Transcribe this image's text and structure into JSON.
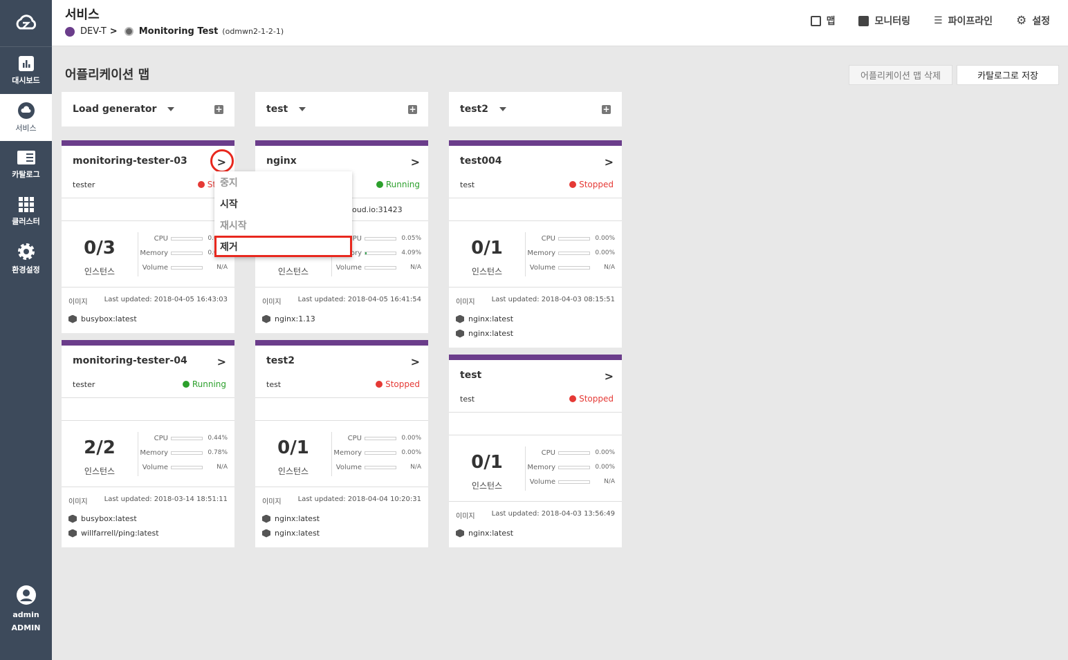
{
  "sidebar": {
    "items": [
      {
        "label": "대시보드",
        "icon": "bar-chart-icon"
      },
      {
        "label": "서비스",
        "icon": "cloud-icon"
      },
      {
        "label": "카탈로그",
        "icon": "book-icon"
      },
      {
        "label": "클러스터",
        "icon": "grid-icon"
      },
      {
        "label": "환경설정",
        "icon": "gear-icon"
      }
    ],
    "user": {
      "name": "admin",
      "role": "ADMIN"
    }
  },
  "header": {
    "title": "서비스",
    "breadcrumb": {
      "project": "DEV-T",
      "separator": ">",
      "service": "Monitoring Test",
      "service_id": "(odmwn2-1-2-1)"
    },
    "nav": [
      {
        "label": "맵"
      },
      {
        "label": "모니터링"
      },
      {
        "label": "파이프라인"
      },
      {
        "label": "설정"
      }
    ]
  },
  "main": {
    "section_title": "어플리케이션 맵",
    "delete_button": "어플리케이션 맵 삭제",
    "save_button": "카탈로그로 저장",
    "groups": [
      {
        "name": "Load generator"
      },
      {
        "name": "test"
      },
      {
        "name": "test2"
      }
    ],
    "labels": {
      "instances": "인스턴스",
      "image": "이미지",
      "cpu": "CPU",
      "memory": "Memory",
      "volume": "Volume",
      "arrow": ">"
    },
    "cards": [
      {
        "name": "monitoring-tester-03",
        "owner": "tester",
        "status": "Stopped",
        "status_shown": "Stop",
        "count": "0/3",
        "cpu": "0.00%",
        "memory": "0.00%",
        "volume": "N/A",
        "updated": "Last updated: 2018-04-05 16:43:03",
        "images": [
          "busybox:latest"
        ]
      },
      {
        "name": "nginx",
        "owner": "",
        "status": "Running",
        "status_shown": "Running",
        "url": "oud.io:31423",
        "count": "",
        "cpu": "0.05%",
        "memory": "4.09%",
        "memory_fraction": 0.04,
        "volume": "N/A",
        "updated": "Last updated: 2018-04-05 16:41:54",
        "images": [
          "nginx:1.13"
        ]
      },
      {
        "name": "test004",
        "owner": "test",
        "status": "Stopped",
        "status_shown": "Stopped",
        "count": "0/1",
        "cpu": "0.00%",
        "memory": "0.00%",
        "volume": "N/A",
        "updated": "Last updated: 2018-04-03 08:15:51",
        "images": [
          "nginx:latest",
          "nginx:latest"
        ]
      },
      {
        "name": "monitoring-tester-04",
        "owner": "tester",
        "status": "Running",
        "status_shown": "Running",
        "count": "2/2",
        "cpu": "0.44%",
        "memory": "0.78%",
        "volume": "N/A",
        "updated": "Last updated: 2018-03-14 18:51:11",
        "images": [
          "busybox:latest",
          "willfarrell/ping:latest"
        ]
      },
      {
        "name": "test2",
        "owner": "test",
        "status": "Stopped",
        "status_shown": "Stopped",
        "count": "0/1",
        "cpu": "0.00%",
        "memory": "0.00%",
        "volume": "N/A",
        "updated": "Last updated: 2018-04-04 10:20:31",
        "images": [
          "nginx:latest",
          "nginx:latest"
        ]
      },
      {
        "name": "test",
        "owner": "test",
        "status": "Stopped",
        "status_shown": "Stopped",
        "count": "0/1",
        "cpu": "0.00%",
        "memory": "0.00%",
        "volume": "N/A",
        "updated": "Last updated: 2018-04-03 13:56:49",
        "images": [
          "nginx:latest"
        ]
      }
    ],
    "context_menu": [
      {
        "label": "중지",
        "enabled": false
      },
      {
        "label": "시작",
        "enabled": true
      },
      {
        "label": "재시작",
        "enabled": false
      },
      {
        "label": "제거",
        "enabled": true,
        "highlighted": true
      }
    ]
  },
  "colors": {
    "sidebar": "#3d4a5b",
    "accent": "#6b3d8b",
    "running": "#2ca02c",
    "stopped": "#e53935",
    "highlight": "#e8281e"
  }
}
